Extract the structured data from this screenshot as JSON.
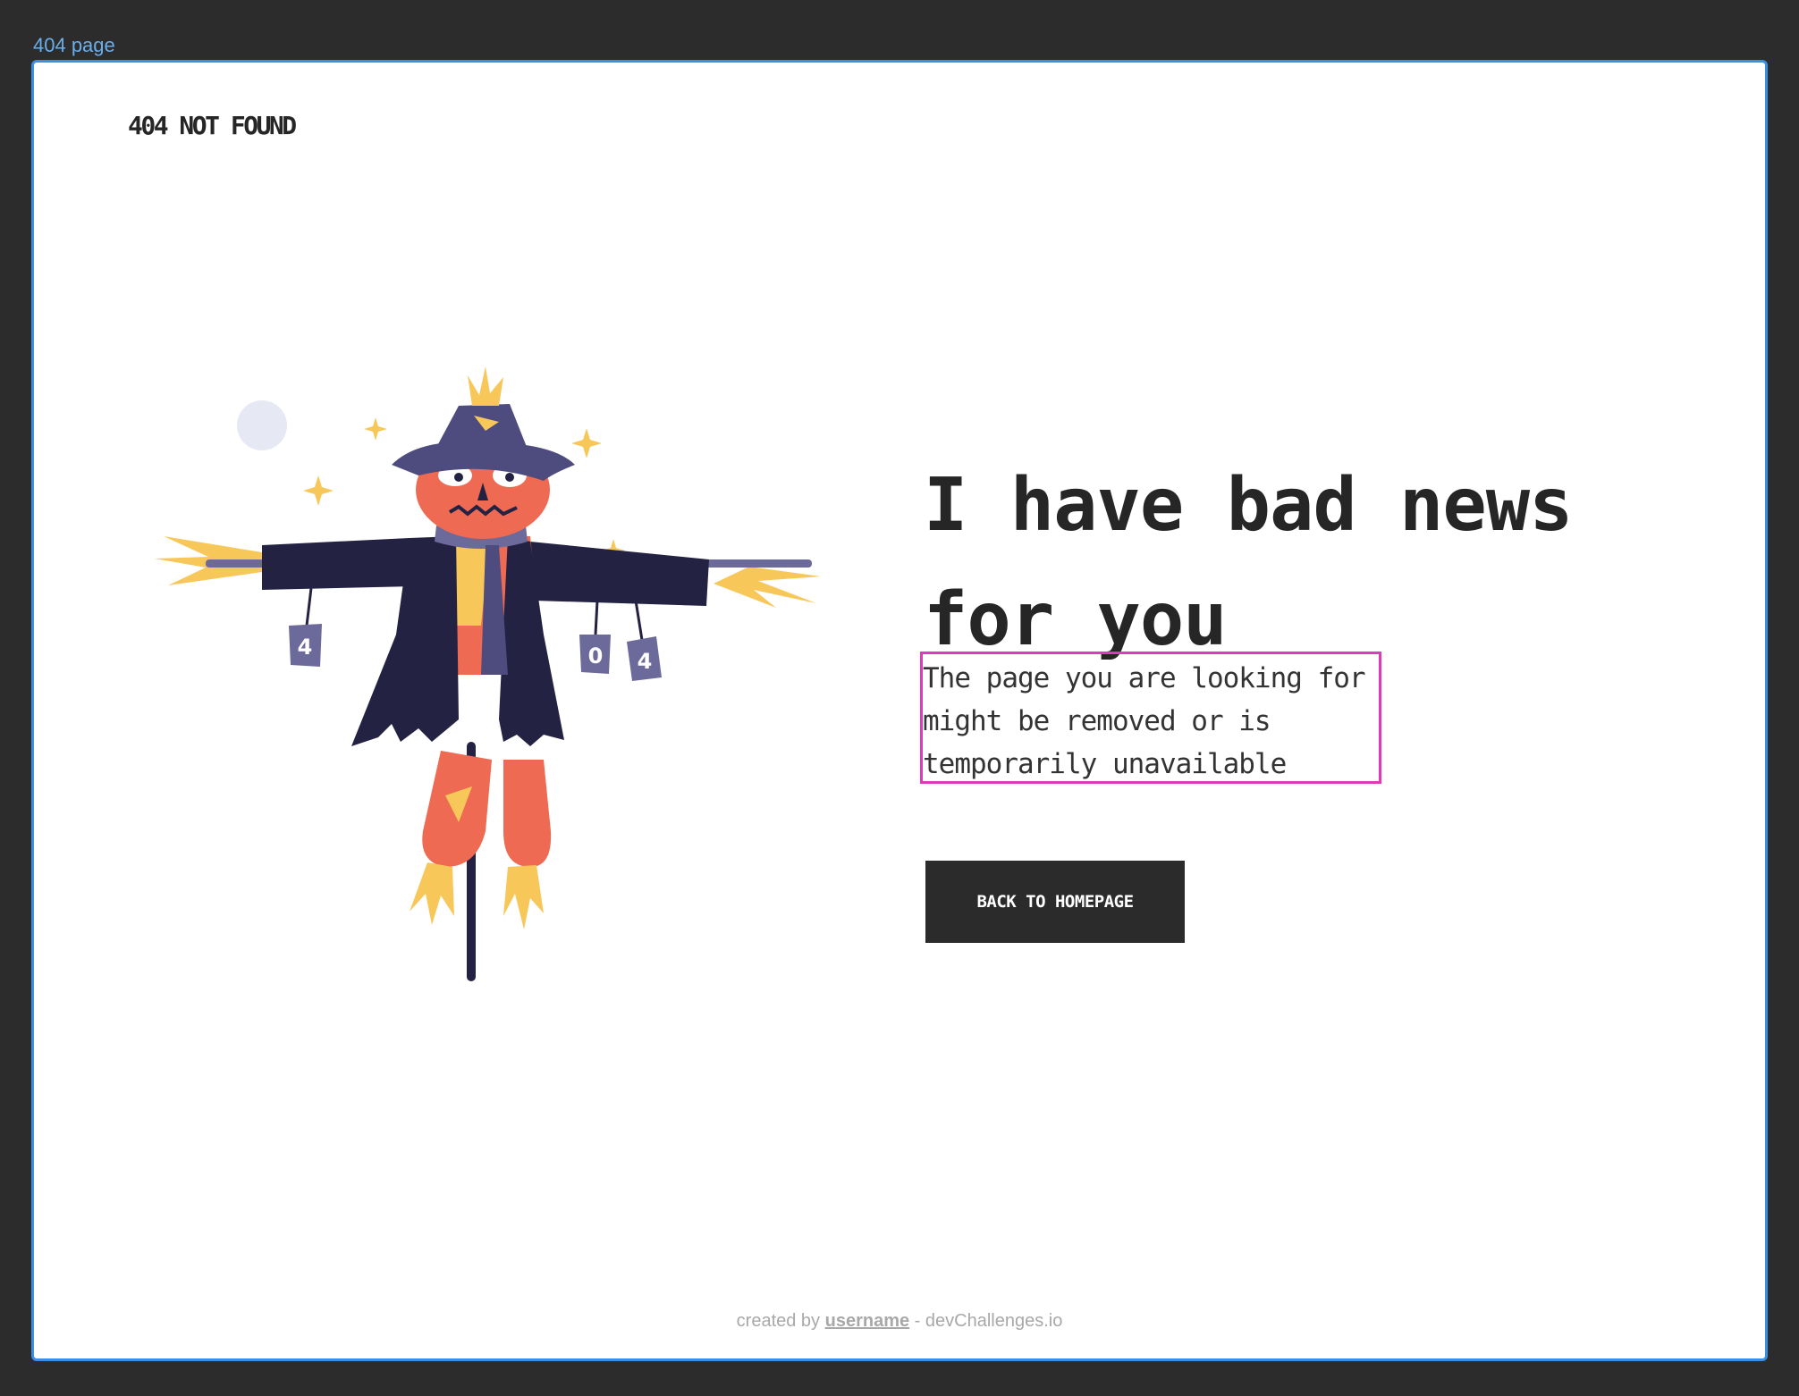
{
  "frame": {
    "label": "404 page",
    "selection_color": "#3a8ee6",
    "highlight_color": "#e03ab8"
  },
  "header": {
    "brand": "404 NOT FOUND"
  },
  "illustration": {
    "name": "scarecrow-illustration",
    "can_labels": [
      "4",
      "0",
      "4"
    ],
    "colors": {
      "hat": "#4e4b7e",
      "coat": "#232242",
      "face": "#ef6a52",
      "straw": "#f8c75a",
      "moon": "#e6e8f3",
      "pole": "#232242"
    }
  },
  "main": {
    "headline": "I have bad news for you",
    "message": "The page you are looking for might be removed or is temporarily unavailable",
    "button_label": "BACK TO HOMEPAGE"
  },
  "footer": {
    "prefix": "created by",
    "username": "username",
    "suffix": "- devChallenges.io"
  }
}
